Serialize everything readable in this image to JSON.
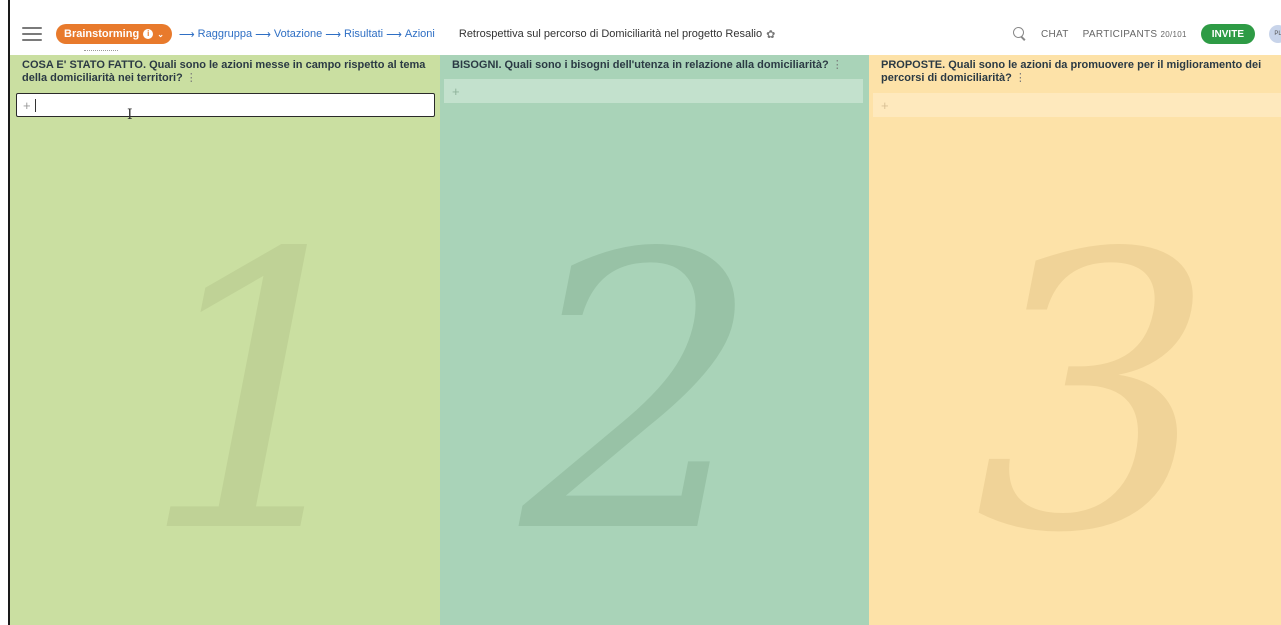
{
  "toolbar": {
    "phase_label": "Brainstorming",
    "steps": [
      "Raggruppa",
      "Votazione",
      "Risultati",
      "Azioni"
    ],
    "arrow": "⟶",
    "session_title": "Retrospettiva sul percorso di Domiciliarità nel progetto Resalio",
    "chat_label": "CHAT",
    "participants_label": "PARTICIPANTS",
    "participants_count": "20/101",
    "invite_label": "INVITE",
    "avatar_initials": "PL"
  },
  "columns": [
    {
      "number": "1",
      "title": "COSA E' STATO FATTO. Quali sono le azioni messe in campo rispetto al tema della domiciliarità nei territori?",
      "color": "#cadfa1"
    },
    {
      "number": "2",
      "title": "BISOGNI. Quali sono i bisogni dell'utenza in relazione alla domiciliarità?",
      "color": "#a9d3b8"
    },
    {
      "number": "3",
      "title": "PROPOSTE. Quali sono le azioni da promuovere per il miglioramento dei percorsi di domiciliarità?",
      "color": "#fde2a8"
    }
  ],
  "add_symbol": "+",
  "icons": {
    "menu": "hamburger-icon",
    "search": "search-icon",
    "settings": "gear-icon",
    "info": "info-icon",
    "options": "kebab-icon"
  },
  "accent_colors": {
    "phase": "#e87a2c",
    "invite": "#2e9b45",
    "link": "#2f6fc4"
  }
}
